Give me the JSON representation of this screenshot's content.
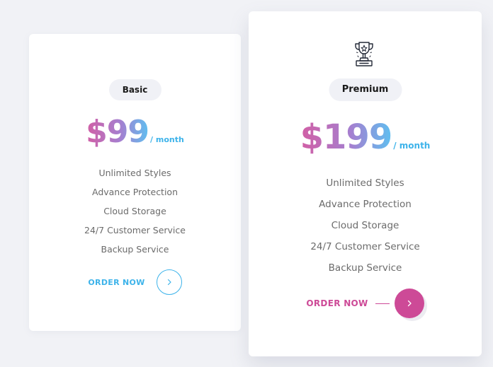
{
  "plans": [
    {
      "name": "Basic",
      "price": "$99",
      "period": "/ month",
      "features": [
        "Unlimited Styles",
        "Advance Protection",
        "Cloud Storage",
        "24/7 Customer Service",
        "Backup Service"
      ],
      "cta": "ORDER NOW",
      "accent": "#3db3ea"
    },
    {
      "name": "Premium",
      "icon": "trophy-icon",
      "price": "$199",
      "period": "/ month",
      "features": [
        "Unlimited Styles",
        "Advance Protection",
        "Cloud Storage",
        "24/7 Customer Service",
        "Backup Service"
      ],
      "cta": "ORDER NOW",
      "accent": "#cd4a97"
    }
  ],
  "colors": {
    "background": "#f1f2f6",
    "card": "#ffffff",
    "badge_bg": "#f0f1f6",
    "gradient_start": "#d25fa5",
    "gradient_mid": "#a57fd0",
    "gradient_end": "#5fbff0",
    "feature_text": "#6b6b6b"
  }
}
